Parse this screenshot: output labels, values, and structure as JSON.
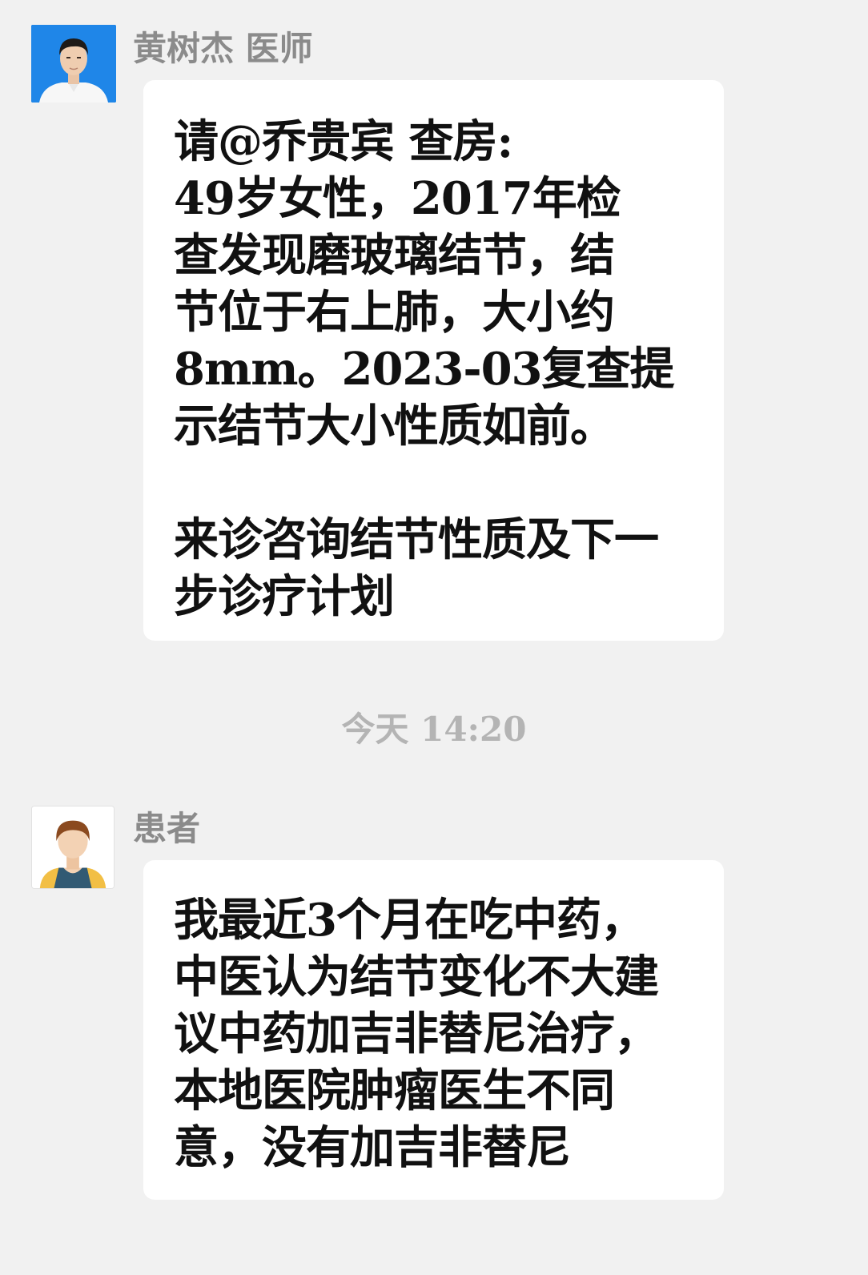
{
  "messages": [
    {
      "sender": "黄树杰 医师",
      "avatar": "doctor-avatar",
      "lines": [
        "请@乔贵宾 查房:",
        "49岁女性，2017年检",
        "查发现磨玻璃结节，结",
        "节位于右上肺，大小约",
        "8mm。2023-03复查提",
        "示结节大小性质如前。",
        "",
        "来诊咨询结节性质及下一",
        "步诊疗计划"
      ]
    },
    {
      "sender": "患者",
      "avatar": "patient-avatar",
      "lines": [
        "我最近3个月在吃中药，",
        "中医认为结节变化不大建",
        "议中药加吉非替尼治疗，",
        "本地医院肿瘤医生不同",
        "意，没有加吉非替尼"
      ]
    }
  ],
  "timestamp": "今天 14:20",
  "colors": {
    "background": "#f1f1f1",
    "bubble": "#ffffff",
    "name": "#8b8b8b",
    "timestamp": "#b4b4b4",
    "text": "#111111",
    "doctor_avatar_bg": "#1f86e8"
  }
}
